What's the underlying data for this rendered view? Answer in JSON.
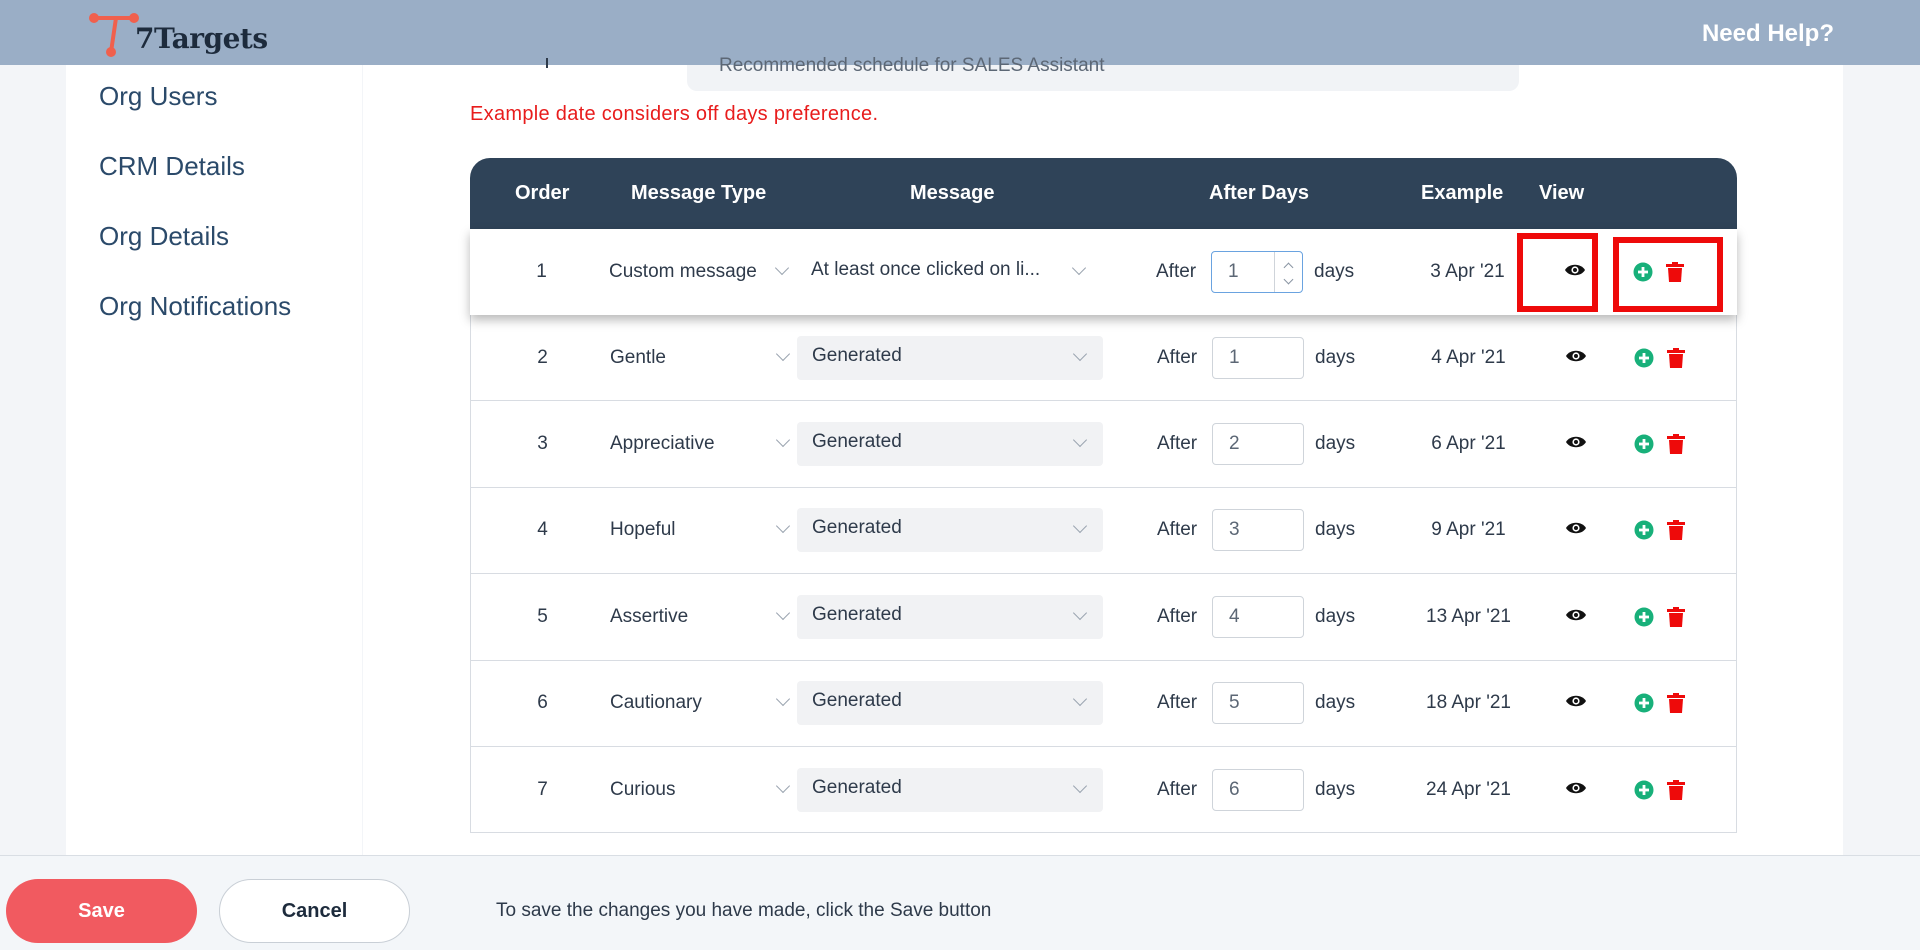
{
  "header": {
    "app_name": "7Targets",
    "help_label": "Need Help?"
  },
  "sidebar": {
    "items": [
      {
        "label": "Org Users"
      },
      {
        "label": "CRM Details"
      },
      {
        "label": "Org Details"
      },
      {
        "label": "Org Notifications"
      }
    ]
  },
  "main": {
    "schedule_text": "Recommended schedule for SALES Assistant",
    "warning": "Example date considers off days preference."
  },
  "table": {
    "headers": {
      "order": "Order",
      "message_type": "Message Type",
      "message": "Message",
      "after_days": "After Days",
      "example": "Example",
      "view": "View"
    },
    "after_label": "After",
    "days_label": "days",
    "rows": [
      {
        "order": "1",
        "type": "Custom message",
        "message": "At least once clicked on li...",
        "days": "1",
        "example": "3 Apr '21"
      },
      {
        "order": "2",
        "type": "Gentle",
        "message": "Generated",
        "days": "1",
        "example": "4 Apr '21"
      },
      {
        "order": "3",
        "type": "Appreciative",
        "message": "Generated",
        "days": "2",
        "example": "6 Apr '21"
      },
      {
        "order": "4",
        "type": "Hopeful",
        "message": "Generated",
        "days": "3",
        "example": "9 Apr '21"
      },
      {
        "order": "5",
        "type": "Assertive",
        "message": "Generated",
        "days": "4",
        "example": "13 Apr '21"
      },
      {
        "order": "6",
        "type": "Cautionary",
        "message": "Generated",
        "days": "5",
        "example": "18 Apr '21"
      },
      {
        "order": "7",
        "type": "Curious",
        "message": "Generated",
        "days": "6",
        "example": "24 Apr '21"
      }
    ]
  },
  "footer": {
    "save_label": "Save",
    "cancel_label": "Cancel",
    "hint": "To save the changes you have made, click the Save button"
  },
  "colors": {
    "header_bg": "#9aaec6",
    "table_header_bg": "#2f4358",
    "warning": "#e81c1c",
    "save_button": "#f15a60",
    "add_icon": "#18b07a",
    "delete_icon": "#ee0a0a",
    "highlight": "#ee0a0a"
  },
  "icons": [
    "logo-icon",
    "eye-icon",
    "add-circle-icon",
    "trash-icon",
    "chevron-down-icon"
  ]
}
